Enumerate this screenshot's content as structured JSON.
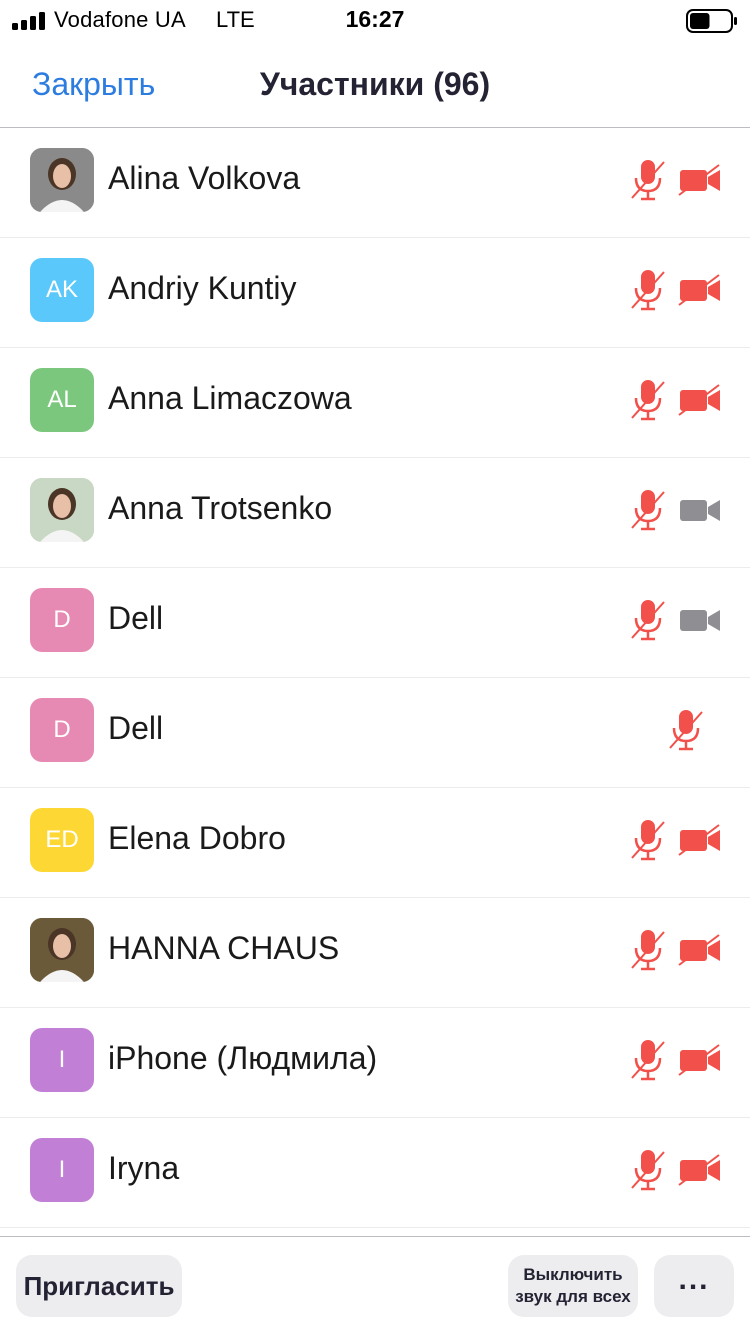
{
  "status_bar": {
    "carrier": "Vodafone UA",
    "network": "LTE",
    "time": "16:27",
    "signal_bars": 4,
    "battery_level": 0.5
  },
  "nav": {
    "close_label": "Закрыть",
    "title": "Участники (96)"
  },
  "colors": {
    "accent": "#2d7ce0",
    "muted_red": "#f2504a",
    "camera_on_gray": "#8e8e93"
  },
  "participants": [
    {
      "name": "Alina Volkova",
      "avatar_type": "photo",
      "initials": "",
      "avatar_color": "#8a8a8a",
      "mic_muted": true,
      "camera": "off"
    },
    {
      "name": "Andriy Kuntiy",
      "avatar_type": "initials",
      "initials": "AK",
      "avatar_color": "#5ac8fa",
      "mic_muted": true,
      "camera": "off"
    },
    {
      "name": "Anna Limaczowa",
      "avatar_type": "initials",
      "initials": "AL",
      "avatar_color": "#7cc77e",
      "mic_muted": true,
      "camera": "off"
    },
    {
      "name": "Anna Trotsenko",
      "avatar_type": "photo",
      "initials": "",
      "avatar_color": "#c9d8c4",
      "mic_muted": true,
      "camera": "on"
    },
    {
      "name": "Dell",
      "avatar_type": "initials",
      "initials": "D",
      "avatar_color": "#e78ab3",
      "mic_muted": true,
      "camera": "on"
    },
    {
      "name": "Dell",
      "avatar_type": "initials",
      "initials": "D",
      "avatar_color": "#e78ab3",
      "mic_muted": true,
      "camera": "none"
    },
    {
      "name": "Elena Dobro",
      "avatar_type": "initials",
      "initials": "ED",
      "avatar_color": "#fdd835",
      "mic_muted": true,
      "camera": "off"
    },
    {
      "name": "HANNA CHAUS",
      "avatar_type": "photo",
      "initials": "",
      "avatar_color": "#6b5a3a",
      "mic_muted": true,
      "camera": "off"
    },
    {
      "name": "iPhone (Людмила)",
      "avatar_type": "initials",
      "initials": "I",
      "avatar_color": "#c17fd6",
      "mic_muted": true,
      "camera": "off"
    },
    {
      "name": "Iryna",
      "avatar_type": "initials",
      "initials": "I",
      "avatar_color": "#c17fd6",
      "mic_muted": true,
      "camera": "off"
    }
  ],
  "bottom_bar": {
    "invite_label": "Пригласить",
    "mute_all_line1": "Выключить",
    "mute_all_line2": "звук для всех",
    "more_label": "..."
  }
}
